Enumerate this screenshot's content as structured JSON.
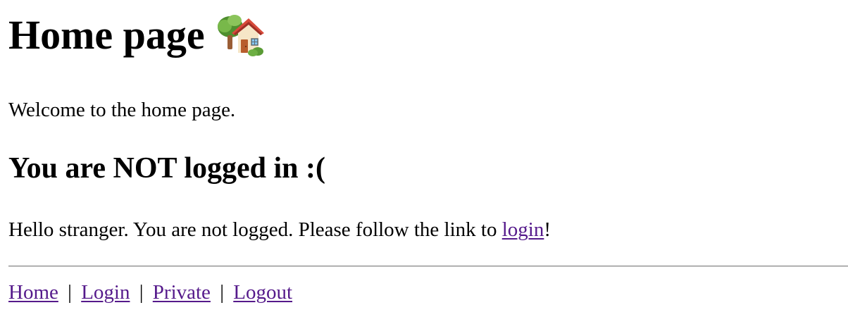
{
  "header": {
    "title": "Home page",
    "title_icon": "house-with-garden-icon"
  },
  "content": {
    "welcome_text": "Welcome to the home page.",
    "status_heading": "You are NOT logged in :(",
    "message_prefix": "Hello stranger. You are not logged. Please follow the link to ",
    "login_link_label": "login",
    "message_suffix": "!"
  },
  "footer_nav": {
    "items": [
      {
        "label": "Home"
      },
      {
        "label": "Login"
      },
      {
        "label": "Private"
      },
      {
        "label": "Logout"
      }
    ],
    "separator": "|"
  },
  "colors": {
    "background": "#ffffff",
    "text": "#000000",
    "visited_link": "#551a8b",
    "divider": "#8a8a8a"
  }
}
